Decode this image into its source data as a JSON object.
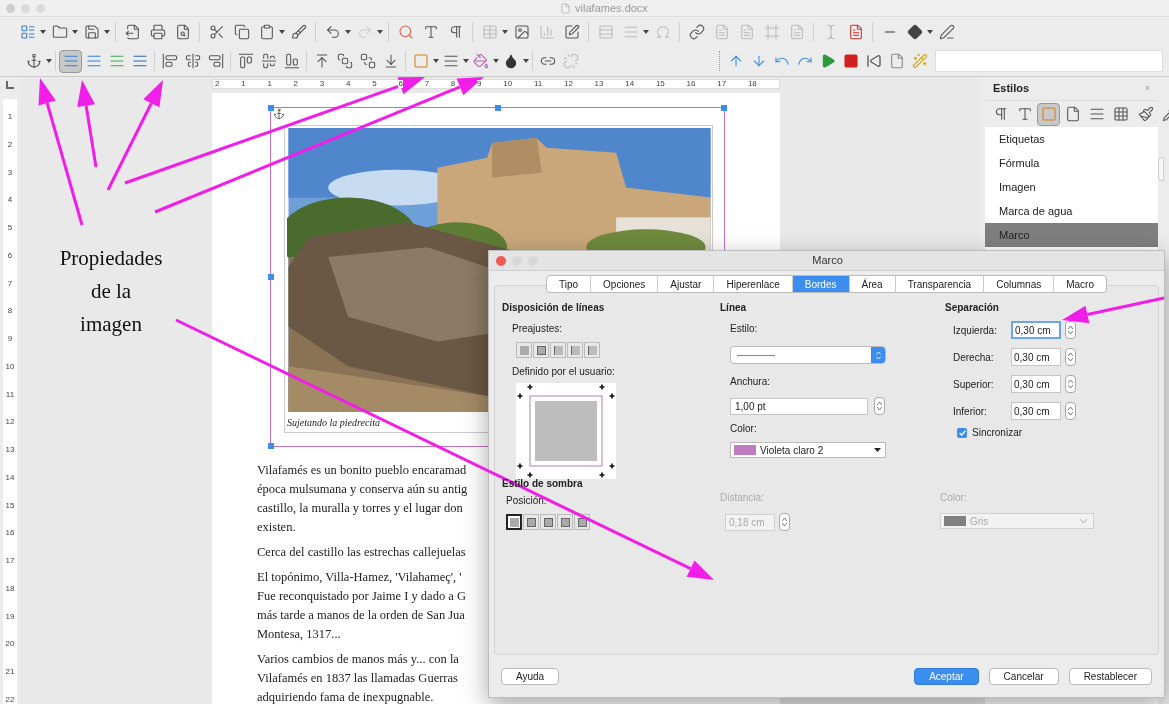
{
  "window": {
    "title": "vilafames.docx"
  },
  "toolbar": {
    "wrap_modes": [
      {
        "selected": true
      },
      {
        "selected": false
      },
      {
        "selected": false
      },
      {
        "selected": false
      }
    ]
  },
  "rulers": {
    "horizontal": [
      "2",
      "1",
      "1",
      "2",
      "3",
      "4",
      "5",
      "6",
      "7",
      "8",
      "9",
      "10",
      "11",
      "12",
      "13",
      "14",
      "15",
      "16",
      "17",
      "18"
    ],
    "vertical": [
      "1",
      "2",
      "3",
      "4",
      "5",
      "6",
      "7",
      "8",
      "9",
      "10",
      "11",
      "12",
      "13",
      "14",
      "15",
      "16",
      "17",
      "18",
      "19",
      "20",
      "21",
      "22"
    ]
  },
  "document": {
    "caption": "Sujetando la piedrecita",
    "paragraphs": [
      {
        "lines": [
          "Vilafamés es un bonito pueblo encaramad",
          "época mulsumana y conserva aún su antig",
          "castillo, la muralla y torres y el lugar don",
          "existen."
        ]
      },
      {
        "lines": [
          "Cerca del castillo las estrechas callejuelas"
        ]
      },
      {
        "lines": [
          "El topónimo, Villa-Hamez, 'Vilahameç', '",
          "Fue reconquistado por Jaime I y dado a G",
          "más tarde a manos de la orden de San Jua",
          "Montesa, 1317..."
        ]
      },
      {
        "lines": [
          "Varios cambios de manos más y... con la",
          "Vilafamés en 1837 las llamadas Guerras",
          "adquiriendo fama de inexpugnable."
        ]
      }
    ]
  },
  "styles_panel": {
    "title": "Estilos",
    "close": "×",
    "families": [
      {
        "selected": false
      },
      {
        "selected": false
      },
      {
        "selected": true
      },
      {
        "selected": false
      },
      {
        "selected": false
      },
      {
        "selected": false
      }
    ],
    "items": [
      {
        "label": "Etiquetas",
        "selected": false
      },
      {
        "label": "Fórmula",
        "selected": false
      },
      {
        "label": "Imagen",
        "selected": false
      },
      {
        "label": "Marca de agua",
        "selected": false
      },
      {
        "label": "Marco",
        "selected": true
      }
    ]
  },
  "annotation": {
    "lines": [
      "Propiedades",
      "de la",
      "imagen"
    ]
  },
  "dialog": {
    "title": "Marco",
    "tabs": [
      {
        "label": "Tipo",
        "selected": false
      },
      {
        "label": "Opciones",
        "selected": false
      },
      {
        "label": "Ajustar",
        "selected": false
      },
      {
        "label": "Hiperenlace",
        "selected": false
      },
      {
        "label": "Bordes",
        "selected": true
      },
      {
        "label": "Área",
        "selected": false
      },
      {
        "label": "Transparencia",
        "selected": false
      },
      {
        "label": "Columnas",
        "selected": false
      },
      {
        "label": "Macro",
        "selected": false
      }
    ],
    "line_layout": {
      "heading": "Disposición de líneas",
      "presets_label": "Preajustes:",
      "user_label": "Definido por el usuario:"
    },
    "line": {
      "heading": "Línea",
      "style_label": "Estilo:",
      "width_label": "Anchura:",
      "width_value": "1,00 pt",
      "color_label": "Color:",
      "color_name": "Violeta claro 2"
    },
    "spacing": {
      "heading": "Separación",
      "fields": [
        {
          "label": "Izquierda:",
          "value": "0,30 cm",
          "focused": true
        },
        {
          "label": "Derecha:",
          "value": "0,30 cm",
          "focused": false
        },
        {
          "label": "Superior:",
          "value": "0,30 cm",
          "focused": false
        },
        {
          "label": "Inferior:",
          "value": "0,30 cm",
          "focused": false
        }
      ],
      "sync": {
        "label": "Sincronizar",
        "checked": true
      }
    },
    "shadow": {
      "heading": "Estilo de sombra",
      "position_label": "Posición:",
      "positions": [
        {
          "selected": true
        },
        {
          "selected": false
        },
        {
          "selected": false
        },
        {
          "selected": false
        },
        {
          "selected": false
        }
      ],
      "distance_label": "Distancia:",
      "distance_value": "0,18 cm",
      "color_label": "Color:",
      "color_name": "Gris",
      "disabled": true
    },
    "buttons": [
      {
        "label": "Ayuda",
        "kind": "plain"
      },
      {
        "label": "Aceptar",
        "kind": "primary"
      },
      {
        "label": "Cancelar",
        "kind": "plain"
      },
      {
        "label": "Restablecer",
        "kind": "plain"
      }
    ]
  }
}
